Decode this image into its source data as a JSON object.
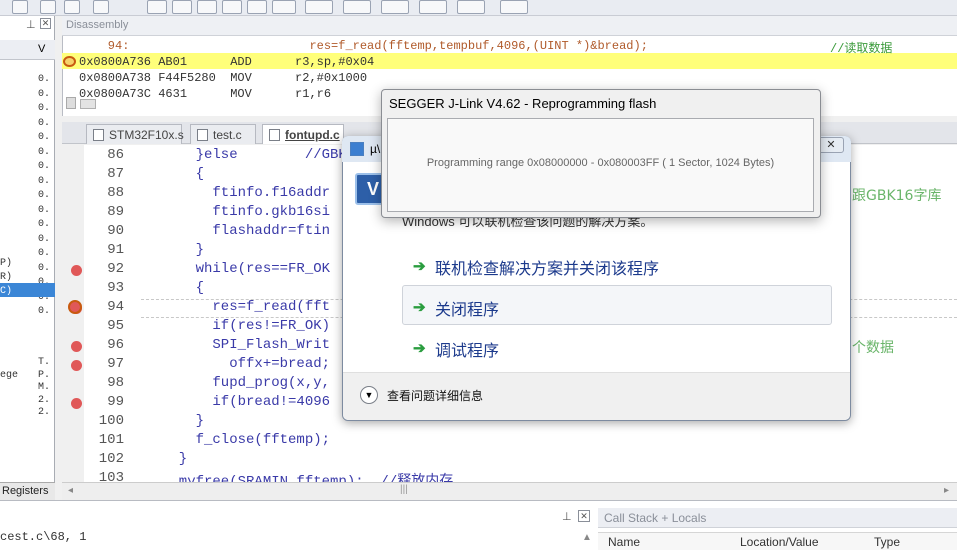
{
  "disassembly": {
    "title": "Disassembly",
    "lines": [
      {
        "text": "    94:                         res=f_read(fftemp,tempbuf,4096,(UINT *)&bread);",
        "comment": "//读取数据"
      },
      {
        "text": "0x0800A736 AB01      ADD      r3,sp,#0x04",
        "comment": ""
      },
      {
        "text": "0x0800A738 F44F5280  MOV      r2,#0x1000",
        "comment": ""
      },
      {
        "text": "0x0800A73C 4631      MOV      r1,r6",
        "comment": ""
      }
    ]
  },
  "tabs": [
    {
      "label": "STM32F10x.s"
    },
    {
      "label": "test.c"
    },
    {
      "label": "fontupd.c"
    }
  ],
  "editor": {
    "lines": [
      {
        "num": "86",
        "code": "    }else        //GBK1",
        "bp": false
      },
      {
        "num": "87",
        "code": "    {",
        "bp": false
      },
      {
        "num": "88",
        "code": "      ftinfo.f16addr",
        "bp": false,
        "right": "跟GBK16字库"
      },
      {
        "num": "89",
        "code": "      ftinfo.gkb16si",
        "bp": false
      },
      {
        "num": "90",
        "code": "      flashaddr=ftin",
        "bp": false
      },
      {
        "num": "91",
        "code": "    }",
        "bp": false
      },
      {
        "num": "92",
        "code": "    while(res==FR_OK",
        "bp": true
      },
      {
        "num": "93",
        "code": "    {",
        "bp": false
      },
      {
        "num": "94",
        "code": "      res=f_read(fft",
        "bp": true
      },
      {
        "num": "95",
        "code": "      if(res!=FR_OK)",
        "bp": false
      },
      {
        "num": "96",
        "code": "      SPI_Flash_Writ",
        "bp": true,
        "right": "个数据"
      },
      {
        "num": "97",
        "code": "        offx+=bread;",
        "bp": true
      },
      {
        "num": "98",
        "code": "      fupd_prog(x,y,",
        "bp": false
      },
      {
        "num": "99",
        "code": "      if(bread!=4096",
        "bp": true
      },
      {
        "num": "100",
        "code": "    }",
        "bp": false
      },
      {
        "num": "101",
        "code": "    f_close(fftemp);",
        "bp": false
      },
      {
        "num": "102",
        "code": "  }",
        "bp": false
      },
      {
        "num": "103",
        "code": "  myfree(SRAMIN,fftemp);  //释放内存",
        "bp": false
      }
    ]
  },
  "left_panel": {
    "header_label": "V",
    "values": [
      "0.",
      "0.",
      "0.",
      "0.",
      "0.",
      "0.",
      "0.",
      "0.",
      "0.",
      "0.",
      "0.",
      "0.",
      "0.",
      "0.",
      "0.",
      "0.",
      "0."
    ],
    "side_labels": [
      "P)",
      "R)",
      "C)"
    ],
    "bottom_labels": [
      {
        "left": "",
        "right": "T."
      },
      {
        "left": "ege",
        "right": "P."
      },
      {
        "left": "",
        "right": "M."
      },
      {
        "left": "",
        "right": "2."
      },
      {
        "left": "",
        "right": "2."
      }
    ],
    "tab_label": "Registers"
  },
  "status": {
    "path": "cest.c\\68, 1",
    "callstack_title": "Call Stack + Locals",
    "col_name": "Name",
    "col_location": "Location/Value",
    "col_type": "Type"
  },
  "error_dialog": {
    "title_fragment": "µ\\",
    "subtitle": "Windows 可以联机检查该问题的解决方案。",
    "options": [
      {
        "label": "联机检查解决方案并关闭该程序"
      },
      {
        "label": "关闭程序"
      },
      {
        "label": "调试程序"
      }
    ],
    "details": "查看问题详细信息"
  },
  "jlink_dialog": {
    "title": "SEGGER J-Link V4.62 - Reprogramming flash",
    "message": "Programming range 0x08000000 - 0x080003FF ( 1 Sector, 1024 Bytes)"
  }
}
